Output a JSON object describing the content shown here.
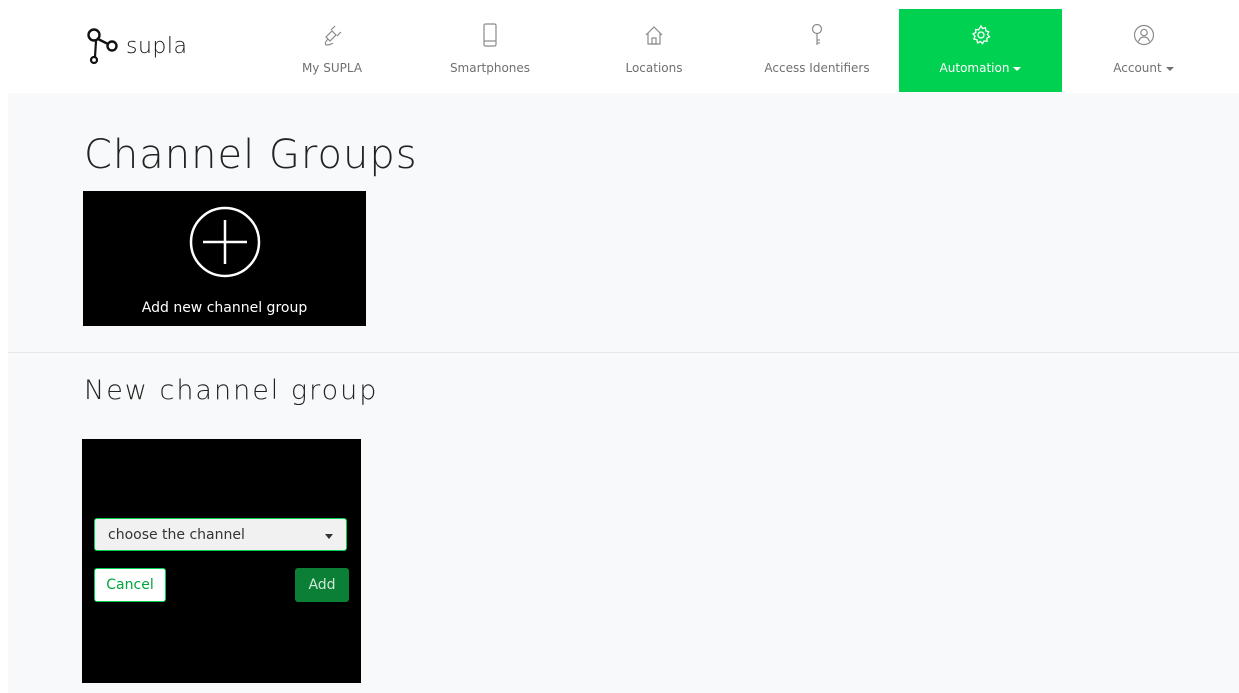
{
  "brand": {
    "name": "supla"
  },
  "nav": {
    "items": [
      {
        "label": "My SUPLA",
        "icon": "plug-icon"
      },
      {
        "label": "Smartphones",
        "icon": "smartphone-icon"
      },
      {
        "label": "Locations",
        "icon": "home-icon"
      },
      {
        "label": "Access Identifiers",
        "icon": "key-icon"
      },
      {
        "label": "Automation",
        "icon": "gear-icon",
        "active": true,
        "dropdown": true
      },
      {
        "label": "Account",
        "icon": "user-icon",
        "dropdown": true
      }
    ]
  },
  "colors": {
    "accent": "#00d150",
    "add_button": "#0b7f35",
    "tile": "#000000",
    "content_bg": "#f8f9fa"
  },
  "page": {
    "title": "Channel Groups"
  },
  "add_tile": {
    "label": "Add new channel group",
    "icon": "plus-circle-icon"
  },
  "new_group": {
    "title": "New channel group",
    "select": {
      "value": "choose the channel"
    },
    "cancel_label": "Cancel",
    "add_label": "Add"
  }
}
